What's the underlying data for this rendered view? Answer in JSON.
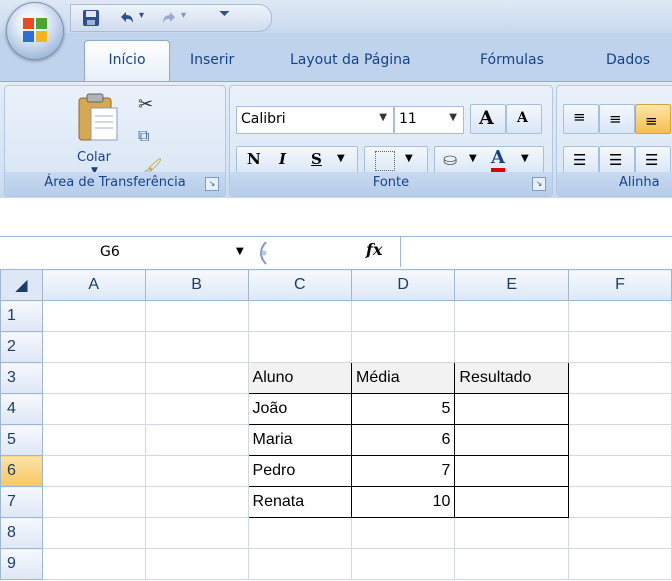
{
  "title_bar": {
    "office_button_icon": "office-logo-icon",
    "quick_access": [
      "save-icon",
      "undo-icon",
      "redo-icon",
      "customize-icon"
    ]
  },
  "tabs": [
    {
      "label": "Início",
      "active": true
    },
    {
      "label": "Inserir",
      "active": false
    },
    {
      "label": "Layout da Página",
      "active": false
    },
    {
      "label": "Fórmulas",
      "active": false
    },
    {
      "label": "Dados",
      "active": false
    }
  ],
  "ribbon": {
    "clipboard": {
      "paste_label": "Colar",
      "group_label": "Área de Transferência"
    },
    "font": {
      "font_name": "Calibri",
      "font_size": "11",
      "bold": "N",
      "italic": "I",
      "underline": "S",
      "grow": "A",
      "shrink": "A",
      "font_color": "A",
      "group_label": "Fonte"
    },
    "alignment": {
      "group_label": "Alinha"
    }
  },
  "formula_bar": {
    "name_box": "G6",
    "fx": "fx",
    "value": ""
  },
  "sheet": {
    "columns": [
      "A",
      "B",
      "C",
      "D",
      "E",
      "F"
    ],
    "rows": [
      "1",
      "2",
      "3",
      "4",
      "5",
      "6",
      "7",
      "8",
      "9"
    ],
    "selected_row": "6",
    "table": {
      "headers": [
        "Aluno",
        "Média",
        "Resultado"
      ],
      "rows": [
        {
          "aluno": "João",
          "media": "5",
          "resultado": ""
        },
        {
          "aluno": "Maria",
          "media": "6",
          "resultado": ""
        },
        {
          "aluno": "Pedro",
          "media": "7",
          "resultado": ""
        },
        {
          "aluno": "Renata",
          "media": "10",
          "resultado": ""
        }
      ]
    }
  },
  "colors": {
    "ribbon_blue": "#bfd3ec",
    "tab_text": "#15428b",
    "selected_header": "#f8c761"
  }
}
